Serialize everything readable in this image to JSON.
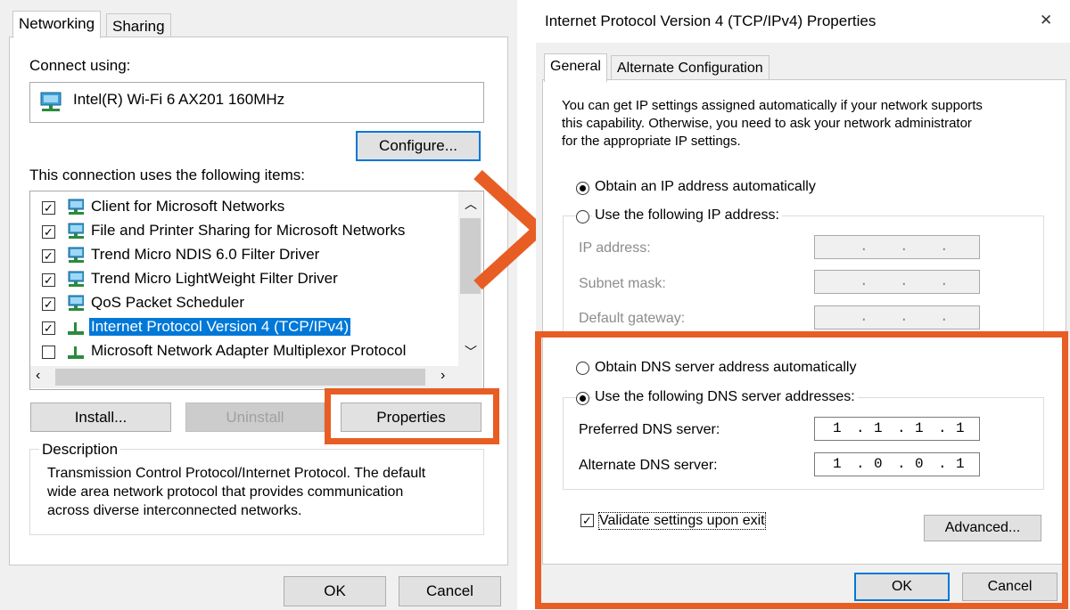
{
  "left_dialog": {
    "tabs": [
      {
        "label": "Networking"
      },
      {
        "label": "Sharing"
      }
    ],
    "connect_using_label": "Connect using:",
    "adapter_name": "Intel(R) Wi-Fi 6 AX201 160MHz",
    "configure_label": "Configure...",
    "items_label": "This connection uses the following items:",
    "items": [
      {
        "label": "Client for Microsoft Networks",
        "checked": true
      },
      {
        "label": "File and Printer Sharing for Microsoft Networks",
        "checked": true
      },
      {
        "label": "Trend Micro NDIS 6.0 Filter Driver",
        "checked": true
      },
      {
        "label": "Trend Micro LightWeight Filter Driver",
        "checked": true
      },
      {
        "label": "QoS Packet Scheduler",
        "checked": true
      },
      {
        "label": "Internet Protocol Version 4 (TCP/IPv4)",
        "checked": true,
        "selected": true
      },
      {
        "label": "Microsoft Network Adapter Multiplexor Protocol",
        "checked": false
      }
    ],
    "install_label": "Install...",
    "uninstall_label": "Uninstall",
    "properties_label": "Properties",
    "description_title": "Description",
    "description_text_1": "Transmission Control Protocol/Internet Protocol. The default",
    "description_text_2": "wide area network protocol that provides communication",
    "description_text_3": "across diverse interconnected networks.",
    "ok_label": "OK",
    "cancel_label": "Cancel"
  },
  "right_dialog": {
    "title": "Internet Protocol Version 4 (TCP/IPv4) Properties",
    "close_glyph": "✕",
    "tabs": [
      {
        "label": "General"
      },
      {
        "label": "Alternate Configuration"
      }
    ],
    "intro_1": "You can get IP settings assigned automatically if your network supports",
    "intro_2": "this capability. Otherwise, you need to ask your network administrator",
    "intro_3": "for the appropriate IP settings.",
    "obtain_ip_label": "Obtain an IP address automatically",
    "use_ip_label": "Use the following IP address:",
    "ip_address_label": "IP address:",
    "subnet_label": "Subnet mask:",
    "gateway_label": "Default gateway:",
    "empty_ip_dots": ".",
    "obtain_dns_label": "Obtain DNS server address automatically",
    "use_dns_label": "Use the following DNS server addresses:",
    "preferred_dns_label": "Preferred DNS server:",
    "preferred_dns": [
      "1",
      "1",
      "1",
      "1"
    ],
    "alternate_dns_label": "Alternate DNS server:",
    "alternate_dns": [
      "1",
      "0",
      "0",
      "1"
    ],
    "validate_label": "Validate settings upon exit",
    "advanced_label": "Advanced...",
    "ok_label": "OK",
    "cancel_label": "Cancel",
    "check_glyph": "✓"
  },
  "annotation_color": "#e85d24",
  "accent_color": "#0078d7"
}
